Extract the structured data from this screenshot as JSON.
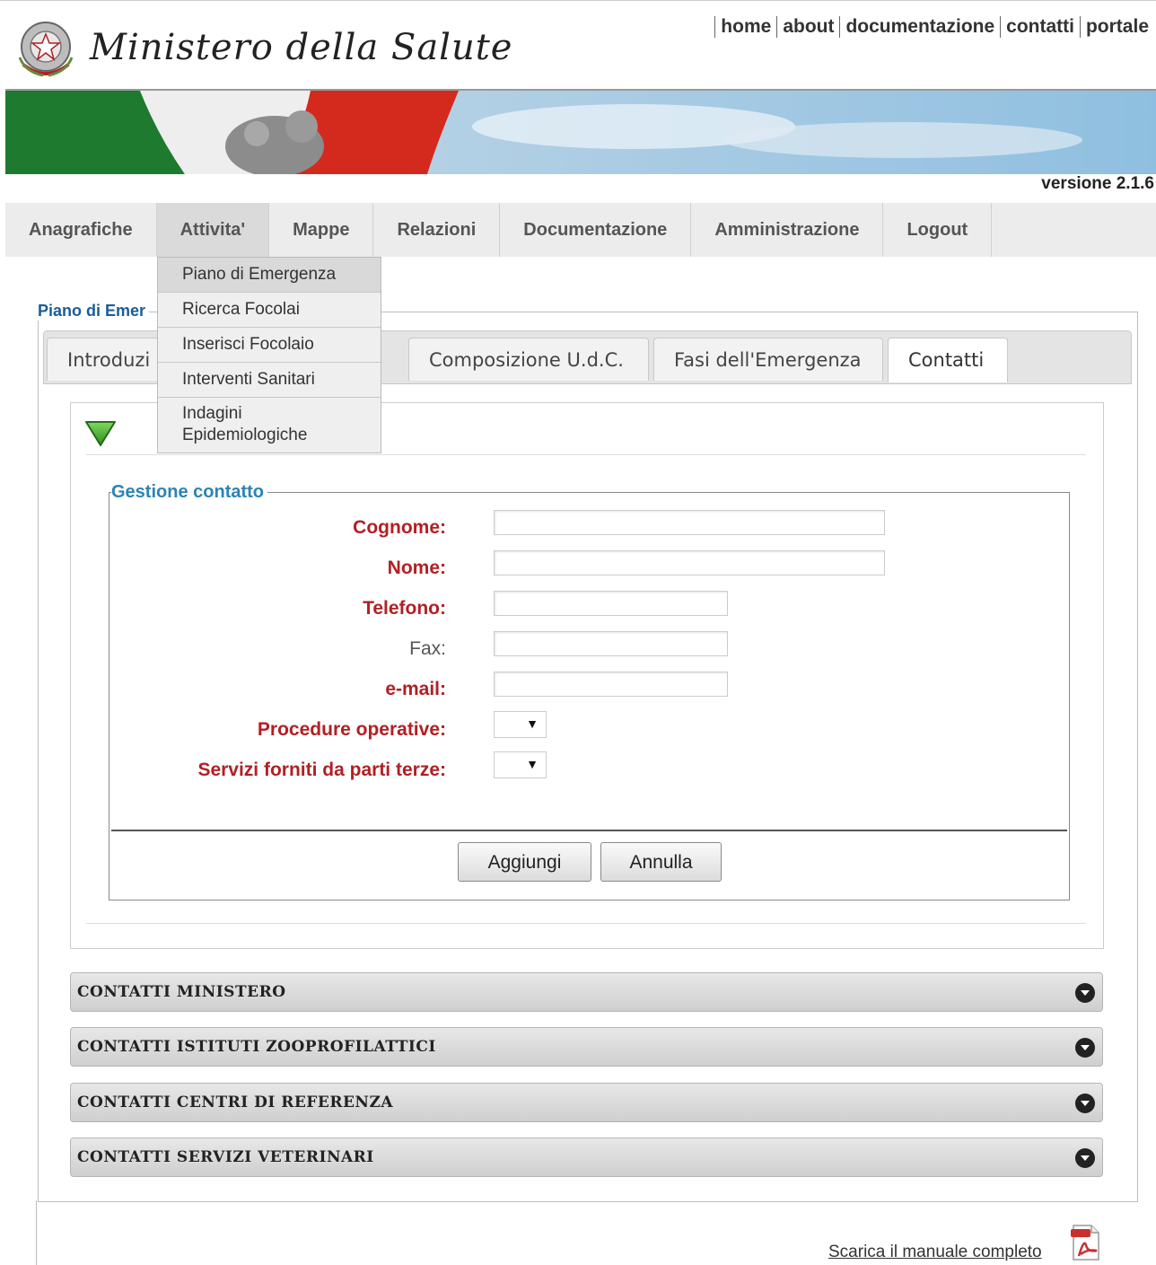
{
  "header": {
    "logo_text": "Ministero della Salute",
    "top_links": [
      "home",
      "about",
      "documentazione",
      "contatti",
      "portale"
    ],
    "version": "versione 2.1.6"
  },
  "menu": {
    "items": [
      "Anagrafiche",
      "Attivita'",
      "Mappe",
      "Relazioni",
      "Documentazione",
      "Amministrazione",
      "Logout"
    ],
    "active": "Attivita'",
    "dropdown": [
      "Piano di Emergenza",
      "Ricerca Focolai",
      "Inserisci Focolaio",
      "Interventi Sanitari",
      "Indagini Epidemiologiche"
    ]
  },
  "page": {
    "legend": "Piano di Emer"
  },
  "tabs": [
    "Introduzi",
    "Composizione U.d.C.",
    "Fasi dell'Emergenza",
    "Contatti"
  ],
  "active_tab": "Contatti",
  "form": {
    "legend": "Gestione contatto",
    "fields": {
      "cognome": {
        "label": "Cognome:",
        "value": ""
      },
      "nome": {
        "label": "Nome:",
        "value": ""
      },
      "telefono": {
        "label": "Telefono:",
        "value": ""
      },
      "fax": {
        "label": "Fax:",
        "value": ""
      },
      "email": {
        "label": "e-mail:",
        "value": ""
      },
      "procedure": {
        "label": "Procedure operative:",
        "value": ""
      },
      "servizi": {
        "label": "Servizi forniti da parti terze:",
        "value": ""
      }
    },
    "add_label": "Aggiungi",
    "cancel_label": "Annulla"
  },
  "accordions": [
    "CONTATTI MINISTERO",
    "CONTATTI ISTITUTI ZOOPROFILATTICI",
    "CONTATTI CENTRI DI REFERENZA",
    "CONTATTI SERVIZI VETERINARI"
  ],
  "footer": {
    "manual_link": "Scarica il manuale completo"
  },
  "icons": [
    "emblem-icon",
    "toggle-down-icon",
    "chevron-down-icon",
    "pdf-icon"
  ],
  "colors": {
    "required_label": "#b21f24",
    "legend_blue": "#2b83b5",
    "menu_bg": "#ececec"
  }
}
